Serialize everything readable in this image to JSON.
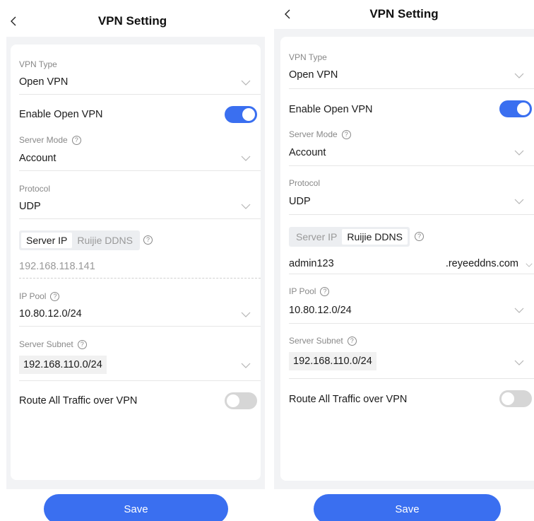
{
  "left": {
    "title": "VPN Setting",
    "vpn_type": {
      "label": "VPN Type",
      "value": "Open VPN"
    },
    "enable": {
      "label": "Enable Open VPN",
      "state": "on"
    },
    "server_mode": {
      "label": "Server Mode",
      "value": "Account"
    },
    "protocol": {
      "label": "Protocol",
      "value": "UDP"
    },
    "server_tabs": [
      "Server IP",
      "Ruijie DDNS"
    ],
    "server_tab_active": "Server IP",
    "server_ip": "192.168.118.141",
    "ip_pool": {
      "label": "IP Pool",
      "value": "10.80.12.0/24"
    },
    "server_subnet": {
      "label": "Server Subnet",
      "value": "192.168.110.0/24"
    },
    "route_all": {
      "label": "Route All Traffic over VPN",
      "state": "off"
    },
    "save_label": "Save"
  },
  "right": {
    "title": "VPN Setting",
    "vpn_type": {
      "label": "VPN Type",
      "value": "Open VPN"
    },
    "enable": {
      "label": "Enable Open VPN",
      "state": "on"
    },
    "server_mode": {
      "label": "Server Mode",
      "value": "Account"
    },
    "protocol": {
      "label": "Protocol",
      "value": "UDP"
    },
    "server_tabs": [
      "Server IP",
      "Ruijie DDNS"
    ],
    "server_tab_active": "Ruijie DDNS",
    "ddns_prefix": "admin123",
    "ddns_suffix": ".reyeeddns.com",
    "ip_pool": {
      "label": "IP Pool",
      "value": "10.80.12.0/24"
    },
    "server_subnet": {
      "label": "Server Subnet",
      "value": "192.168.110.0/24"
    },
    "route_all": {
      "label": "Route All Traffic over VPN",
      "state": "off"
    },
    "save_label": "Save"
  },
  "help_glyph": "?",
  "colors": {
    "accent": "#3a6ff0",
    "toggle_off": "#d6d6d6",
    "panel_bg": "#f2f3f5"
  }
}
